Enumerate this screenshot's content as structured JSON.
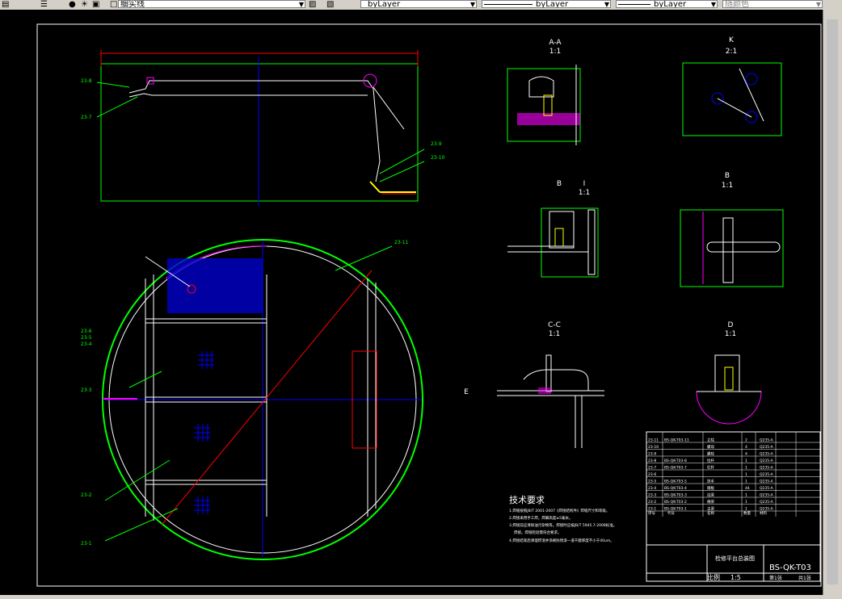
{
  "toolbar": {
    "layer_name": "细实线",
    "color_label": "byLayer",
    "linetype_label": "byLayer",
    "lineweight_label": "byLayer",
    "plotstyle_label": "随颜色"
  },
  "drawing": {
    "sections": {
      "aa": {
        "title": "A-A",
        "scale": "1:1"
      },
      "k": {
        "title": "K",
        "scale": "2:1"
      },
      "i": {
        "marker": "B",
        "title": "I",
        "scale": "1:1"
      },
      "b": {
        "title": "B",
        "scale": "1:1"
      },
      "cc": {
        "title": "C-C",
        "scale": "1:1",
        "view_marker": "E"
      },
      "d": {
        "title": "D",
        "scale": "1:1"
      }
    },
    "callouts": [
      "23-8",
      "23-7",
      "23-9",
      "23-10",
      "23-11",
      "23-6",
      "23-5",
      "23-4",
      "23-3",
      "23-2",
      "23-1"
    ],
    "tech_req": {
      "heading": "技术要求",
      "items": [
        "1.焊缝按照JB/T 2001-2007《焊接结构件》焊缝尺寸和等级。",
        "2.焊接采用手工焊。焊脚高度≥5毫米。",
        "3.焊接前应清除油污杂物等。焊接时应按JB/T 5945.7-2008标准。",
        "焊接。焊缝检验需符合要求。",
        "4.焊接结束后清理焊渣并涂刷防锈漆一道干膜厚度不小于40um。"
      ]
    },
    "title_block": {
      "drawing_no": "BS-QK-T03",
      "name": "检修平台总装图",
      "scale_label": "比例",
      "scale": "1:5",
      "sheet": "第1张",
      "total": "共1张"
    },
    "parts": [
      {
        "no": "23-11",
        "code": "BS-QK-T03-11",
        "name": "立柱",
        "qty": "2",
        "mat": "Q235-A"
      },
      {
        "no": "23-10",
        "code": "",
        "name": "螺母",
        "qty": "4",
        "mat": "Q235-A"
      },
      {
        "no": "23-9",
        "code": "",
        "name": "螺栓",
        "qty": "4",
        "mat": "Q235-A"
      },
      {
        "no": "23-8",
        "code": "BS-QK-T03-8",
        "name": "拉杆",
        "qty": "1",
        "mat": "Q235-A"
      },
      {
        "no": "23-7",
        "code": "BS-QK-T03-7",
        "name": "栏杆",
        "qty": "1",
        "mat": "Q235-A"
      },
      {
        "no": "23-6",
        "code": "",
        "name": "",
        "qty": "1",
        "mat": "Q235-A"
      },
      {
        "no": "23-5",
        "code": "BS-QK-T03-5",
        "name": "扶手",
        "qty": "1",
        "mat": "Q235-A"
      },
      {
        "no": "23-4",
        "code": "BS-QK-T03-4",
        "name": "踏板",
        "qty": "44",
        "mat": "Q235-A"
      },
      {
        "no": "23-3",
        "code": "BS-QK-T03-3",
        "name": "边梁",
        "qty": "1",
        "mat": "Q235-A"
      },
      {
        "no": "23-2",
        "code": "BS-QK-T03-2",
        "name": "横梁",
        "qty": "1",
        "mat": "Q235-A"
      },
      {
        "no": "23-1",
        "code": "BS-QK-T03-1",
        "name": "主梁",
        "qty": "1",
        "mat": "Q235-A"
      }
    ],
    "parts_header": {
      "no": "序号",
      "code": "代号",
      "name": "名称",
      "qty": "数量",
      "mat": "材料"
    }
  },
  "colors": {
    "frame": "#ffffff",
    "green": "#00ff00",
    "cyan": "#00ffff",
    "red": "#ff0000",
    "blue": "#0000ff",
    "yellow": "#ffff00",
    "magenta": "#ff00ff"
  }
}
